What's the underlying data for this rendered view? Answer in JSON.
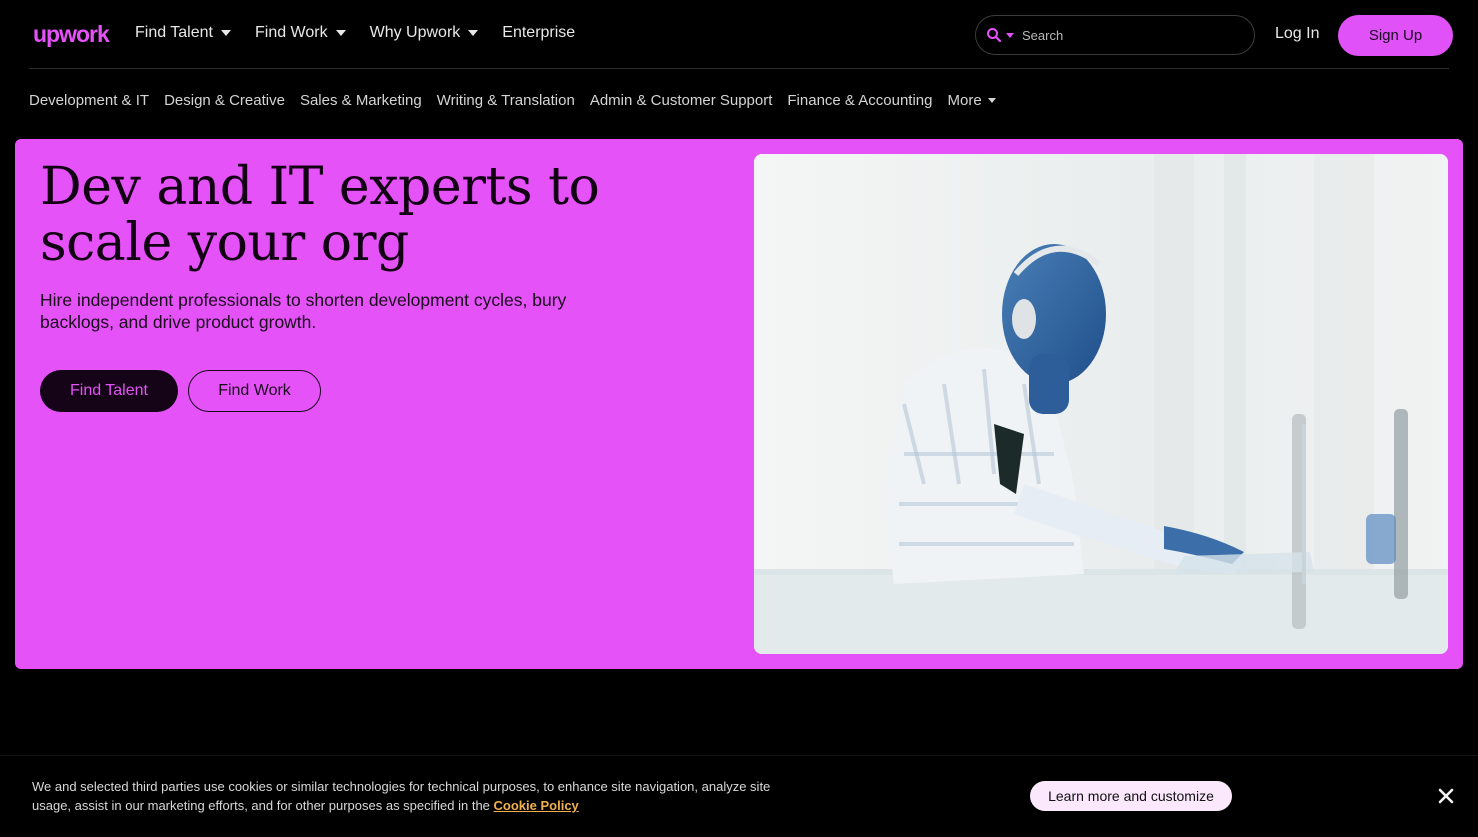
{
  "header": {
    "logo_text": "upwork",
    "nav": [
      {
        "label": "Find Talent",
        "has_caret": true
      },
      {
        "label": "Find Work",
        "has_caret": true
      },
      {
        "label": "Why Upwork",
        "has_caret": true
      },
      {
        "label": "Enterprise",
        "has_caret": false
      }
    ],
    "search_placeholder": "Search",
    "login_label": "Log In",
    "signup_label": "Sign Up"
  },
  "categories": {
    "items": [
      "Development & IT",
      "Design & Creative",
      "Sales & Marketing",
      "Writing & Translation",
      "Admin & Customer Support",
      "Finance & Accounting"
    ],
    "more_label": "More"
  },
  "hero": {
    "title": "Dev and IT experts to scale your org",
    "subtitle": "Hire independent professionals to shorten development cycles, bury backlogs, and drive product growth.",
    "primary_button": "Find Talent",
    "secondary_button": "Find Work",
    "image_subject": "person-with-headphones-typing-on-laptop"
  },
  "cookie_banner": {
    "text": "We and selected third parties use cookies or similar technologies for technical purposes, to enhance site navigation, analyze site usage, assist in our marketing efforts, and for other purposes as specified in the",
    "link_label": "Cookie Policy",
    "button_label": "Learn more and customize"
  },
  "colors": {
    "brand": "#e552f8",
    "background": "#000000",
    "link_accent": "#f0b050"
  }
}
